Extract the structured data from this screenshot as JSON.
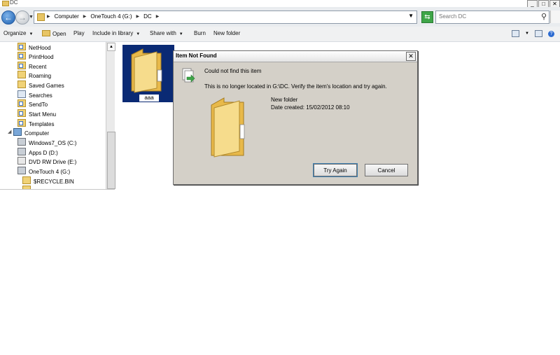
{
  "window": {
    "title": "DC",
    "controls": [
      "_",
      "□",
      "✕"
    ]
  },
  "address": {
    "crumbs": [
      "Computer",
      "OneTouch 4 (G:)",
      "DC"
    ],
    "search_placeholder": "Search DC"
  },
  "toolbar": {
    "organize": "Organize",
    "open": "Open",
    "play": "Play",
    "include": "Include in library",
    "share": "Share with",
    "burn": "Burn",
    "new_folder": "New folder"
  },
  "nav": {
    "items": [
      "NetHood",
      "PrintHood",
      "Recent",
      "Roaming",
      "Saved Games",
      "Searches",
      "SendTo",
      "Start Menu",
      "Templates",
      "Computer",
      "Windows7_OS (C:)",
      "Apps D (D:)",
      "DVD RW Drive (E:)",
      "OneTouch 4 (G:)",
      "$RECYCLE.BIN"
    ]
  },
  "content": {
    "selected_item": "aaa"
  },
  "dialog": {
    "title": "Item Not Found",
    "heading": "Could not find this item",
    "message": "This is no longer located in G:\\DC. Verify the item's location and try again.",
    "item_name": "New folder",
    "item_date": "Date created: 15/02/2012 08:10",
    "try_again": "Try Again",
    "cancel": "Cancel"
  },
  "colors": {
    "selection": "#0a2a74",
    "dialog_bg": "#d4d0c8",
    "folder": "#f0d277"
  },
  "icons": {
    "back": "back-arrow-icon",
    "forward": "forward-arrow-icon",
    "refresh": "refresh-icon",
    "search": "search-icon",
    "folder": "folder-icon"
  }
}
